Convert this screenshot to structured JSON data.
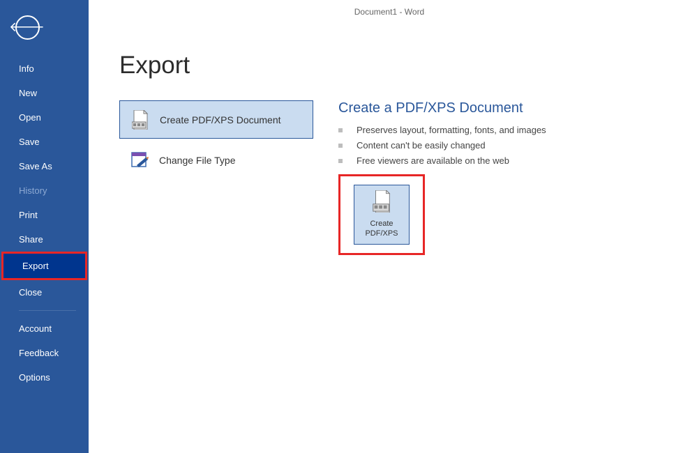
{
  "titlebar": {
    "text": "Document1  -  Word"
  },
  "sidebar": {
    "items": [
      {
        "label": "Info"
      },
      {
        "label": "New"
      },
      {
        "label": "Open"
      },
      {
        "label": "Save"
      },
      {
        "label": "Save As"
      },
      {
        "label": "History"
      },
      {
        "label": "Print"
      },
      {
        "label": "Share"
      },
      {
        "label": "Export"
      },
      {
        "label": "Close"
      },
      {
        "label": "Account"
      },
      {
        "label": "Feedback"
      },
      {
        "label": "Options"
      }
    ]
  },
  "main": {
    "heading": "Export",
    "options": [
      {
        "label": "Create PDF/XPS Document"
      },
      {
        "label": "Change File Type"
      }
    ],
    "detail": {
      "title": "Create a PDF/XPS Document",
      "bullets": [
        "Preserves layout, formatting, fonts, and images",
        "Content can't be easily changed",
        "Free viewers are available on the web"
      ],
      "buttonLabel": "Create PDF/XPS"
    }
  }
}
